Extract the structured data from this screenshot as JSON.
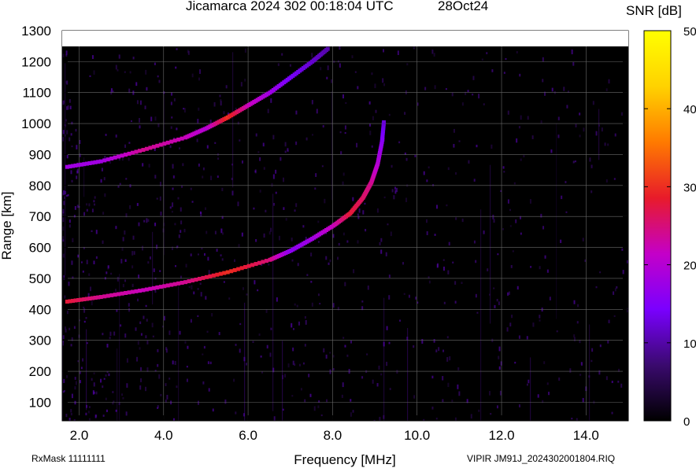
{
  "header": {
    "title": "Jicamarca 2024 302 00:18:04 UTC",
    "date": "28Oct24"
  },
  "footer": {
    "rxmask": "RxMask 11111111",
    "file": "VIPIR  JM91J_2024302001804.RIQ"
  },
  "colorbar": {
    "label": "SNR [dB]",
    "ticks": [
      "50",
      "40",
      "30",
      "20",
      "10",
      "0"
    ],
    "min": 0,
    "max": 50,
    "colors": [
      "#000000",
      "#3a0a6e",
      "#7a00ff",
      "#c400c8",
      "#e81b2a",
      "#ff7a00",
      "#ffd200",
      "#ffff00"
    ]
  },
  "chart_data": {
    "type": "heatmap",
    "title": "Jicamarca 2024 302 00:18:04 UTC",
    "xlabel": "Frequency [MHz]",
    "ylabel": "Range [km]",
    "xlim": [
      1.6,
      15.0
    ],
    "ylim": [
      40,
      1300
    ],
    "x_ticks": [
      "2.0",
      "4.0",
      "6.0",
      "8.0",
      "10.0",
      "12.0",
      "14.0"
    ],
    "y_ticks": [
      "100",
      "200",
      "300",
      "400",
      "500",
      "600",
      "700",
      "800",
      "900",
      "1000",
      "1100",
      "1200",
      "1300"
    ],
    "grid": true,
    "traces": [
      {
        "kind": "F-layer echo",
        "points": [
          [
            1.7,
            425
          ],
          [
            2.5,
            440
          ],
          [
            3.5,
            462
          ],
          [
            4.5,
            488
          ],
          [
            5.5,
            520
          ],
          [
            6.5,
            560
          ],
          [
            7.0,
            590
          ],
          [
            7.5,
            628
          ],
          [
            8.0,
            670
          ],
          [
            8.4,
            710
          ],
          [
            8.7,
            760
          ],
          [
            8.9,
            810
          ],
          [
            9.05,
            870
          ],
          [
            9.15,
            940
          ],
          [
            9.2,
            1010
          ]
        ],
        "snr_db": [
          28,
          24,
          22,
          24,
          30,
          25,
          16,
          18,
          22,
          28,
          26,
          24,
          20,
          16,
          12
        ]
      },
      {
        "kind": "second-hop echo",
        "points": [
          [
            1.7,
            860
          ],
          [
            2.5,
            878
          ],
          [
            3.5,
            915
          ],
          [
            4.5,
            955
          ],
          [
            5.0,
            985
          ],
          [
            5.5,
            1020
          ],
          [
            6.0,
            1060
          ],
          [
            6.5,
            1100
          ],
          [
            7.0,
            1150
          ],
          [
            7.5,
            1200
          ],
          [
            7.9,
            1245
          ]
        ],
        "snr_db": [
          18,
          18,
          24,
          22,
          20,
          30,
          22,
          18,
          14,
          12,
          10
        ]
      }
    ]
  }
}
